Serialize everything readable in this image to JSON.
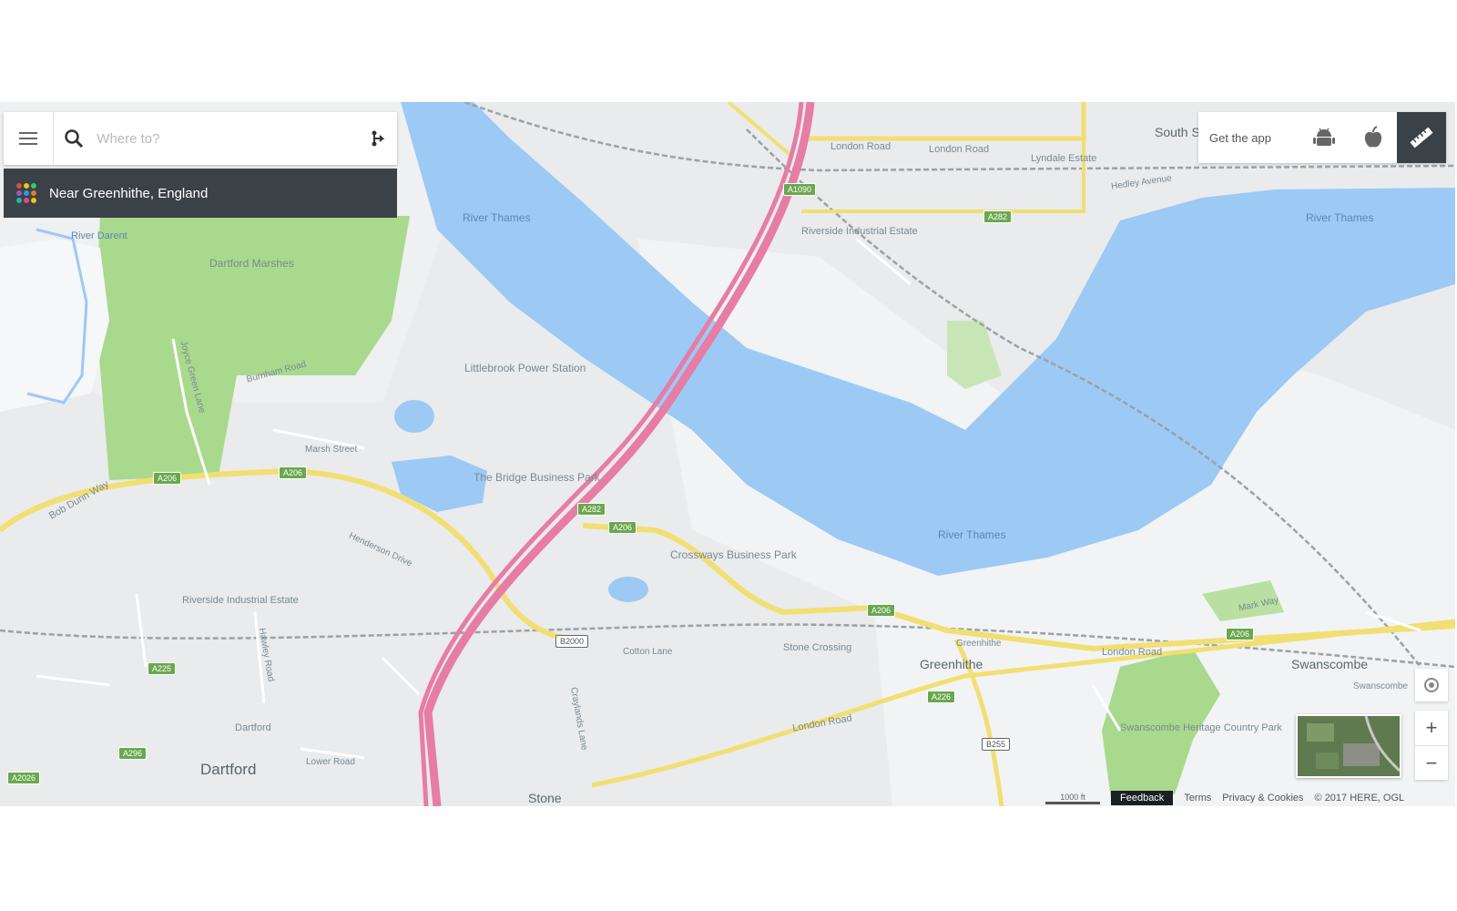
{
  "search": {
    "placeholder": "Where to?"
  },
  "location": {
    "label": "Near Greenhithe, England"
  },
  "appbar": {
    "get_app": "Get the app"
  },
  "footer": {
    "scale": "1000 ft",
    "feedback": "Feedback",
    "terms": "Terms",
    "privacy": "Privacy & Cookies",
    "copyright": "© 2017 HERE, OGL"
  },
  "icons": [
    "menu-icon",
    "search-icon",
    "route-icon",
    "android-icon",
    "apple-icon",
    "ruler-icon",
    "locate-icon",
    "zoom-in-icon",
    "zoom-out-icon"
  ],
  "colors": {
    "water": "#9dc9f5",
    "park": "#a9d98d",
    "motorway": "#e77ca4",
    "road": "#f2df72",
    "panel_dark": "#3a4147"
  },
  "map": {
    "places": {
      "dartford": "Dartford",
      "greenhithe": "Greenhithe",
      "swanscombe": "Swanscombe",
      "stone": "Stone",
      "south_stifford": "South Stifford",
      "river_thames_1": "River Thames",
      "river_thames_2": "River Thames",
      "river_thames_3": "River Thames",
      "river_darent": "River Darent",
      "dartford_marshes": "Dartford Marshes",
      "littlebrook": "Littlebrook Power Station",
      "bridge_park": "The Bridge Business Park",
      "crossways": "Crossways Business Park",
      "riverside_north": "Riverside Industrial Estate",
      "riverside_south": "Riverside Industrial Estate",
      "lyndale": "Lyndale Estate",
      "swanscombe_park": "Swanscombe Heritage Country Park",
      "stone_crossing": "Stone Crossing",
      "greenhithe_station": "Greenhithe",
      "swanscombe_station": "Swanscombe",
      "dartford_station": "Dartford"
    },
    "roads": {
      "london_road_1": "London Road",
      "london_road_2": "London Road",
      "london_road_3": "London Road",
      "london_road_4": "London Road",
      "hedley": "Hedley Avenue",
      "burnham": "Burnham Road",
      "bob_dunn": "Bob Dunn Way",
      "cotton_lane": "Cotton Lane",
      "craylands": "Craylands Lane",
      "henderson": "Henderson Drive",
      "hawley": "Hawley Road",
      "joyce_green": "Joyce Green Lane",
      "mark_way": "Mark Way",
      "marsh_street": "Marsh Street",
      "lower_road": "Lower Road"
    },
    "shields": {
      "a1090": "A1090",
      "a282_n": "A282",
      "a206_1": "A206",
      "a206_2": "A206",
      "a282_s": "A282",
      "a206_3": "A206",
      "a206_4": "A206",
      "a226": "A226",
      "a206_5": "A206",
      "b255": "B255",
      "b2000": "B2000",
      "a296": "A296",
      "a225": "A225",
      "a2026": "A2026"
    }
  }
}
